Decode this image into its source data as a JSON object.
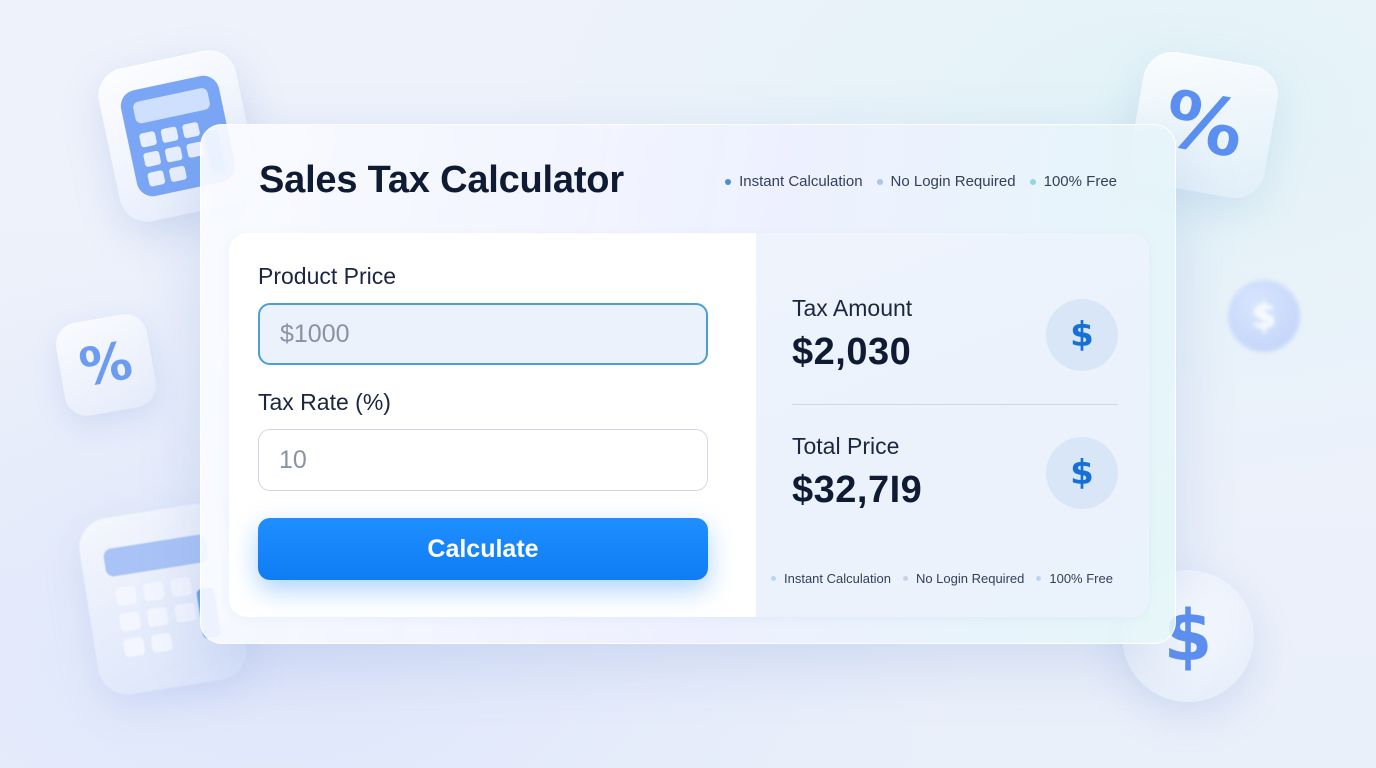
{
  "app": {
    "title": "Sales Tax Calculator"
  },
  "features": [
    {
      "label": "Instant Calculation",
      "dot_color": "#4a8fd6"
    },
    {
      "label": "No Login Required",
      "dot_color": "#a9c7ea"
    },
    {
      "label": "100% Free",
      "dot_color": "#8fd7e3"
    }
  ],
  "form": {
    "price_label": "Product Price",
    "price_value": "$1000",
    "rate_label": "Tax Rate (%)",
    "rate_value": "10",
    "calculate_label": "Calculate"
  },
  "results": {
    "tax_label": "Tax Amount",
    "tax_value": "$2,030",
    "total_label": "Total Price",
    "total_value": "$32,7I9"
  },
  "icons": {
    "dollar": "$",
    "percent": "%",
    "result_icons": [
      "dollar-icon",
      "dollar-icon"
    ],
    "decorations": [
      "calculator-icon",
      "percent-icon",
      "dollar-coin-icon"
    ]
  },
  "colors": {
    "accent": "#0f7cf4",
    "title": "#0f1b33",
    "icon_blue": "#1670d6"
  }
}
